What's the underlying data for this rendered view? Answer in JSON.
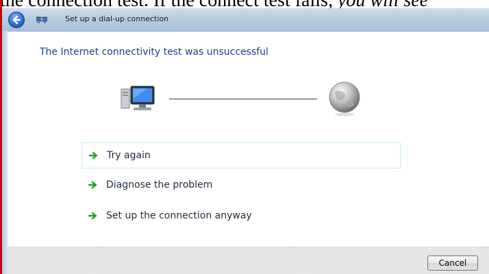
{
  "document": {
    "text_before": "the connection test. If the connect test fails, ",
    "text_italic": "you will see"
  },
  "window": {
    "title": "Set up a dial-up connection",
    "heading": "The Internet connectivity test was unsuccessful"
  },
  "options": [
    {
      "label": "Try again",
      "focused": true
    },
    {
      "label": "Diagnose the problem",
      "focused": false
    },
    {
      "label": "Set up the connection anyway",
      "focused": false
    }
  ],
  "footer": {
    "cancel_label": "Cancel"
  },
  "icons": {
    "back": "back-arrow-icon",
    "title": "dial-up-connection-icon",
    "computer": "computer-icon",
    "internet": "globe-icon",
    "option_arrow": "green-arrow-icon"
  },
  "colors": {
    "heading": "#1e3f8a",
    "arrow": "#1aa31a",
    "titlebar": "#b9cde2",
    "frame": "#d40000"
  }
}
